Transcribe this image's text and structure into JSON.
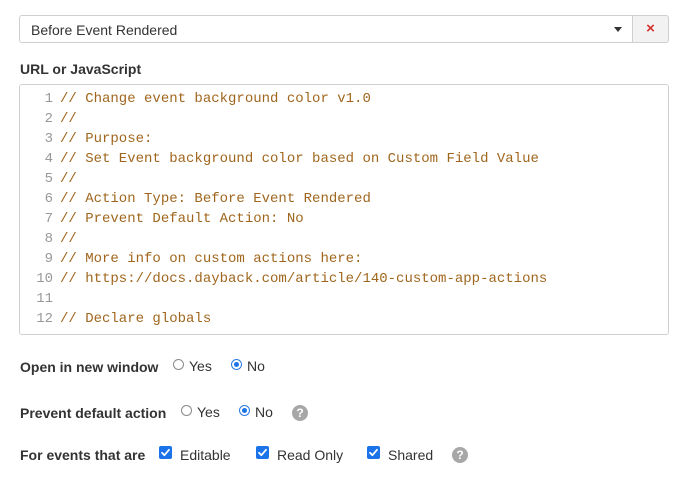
{
  "event_select": {
    "value": "Before Event Rendered",
    "clear_icon": "×"
  },
  "url_field": {
    "label": "URL or JavaScript"
  },
  "editor": {
    "lines": [
      {
        "num": "1",
        "text": "// Change event background color v1.0"
      },
      {
        "num": "2",
        "text": "//"
      },
      {
        "num": "3",
        "text": "// Purpose:"
      },
      {
        "num": "4",
        "text": "// Set Event background color based on Custom Field Value"
      },
      {
        "num": "5",
        "text": "//"
      },
      {
        "num": "6",
        "text": "// Action Type: Before Event Rendered"
      },
      {
        "num": "7",
        "text": "// Prevent Default Action: No"
      },
      {
        "num": "8",
        "text": "//"
      },
      {
        "num": "9",
        "text": "// More info on custom actions here:"
      },
      {
        "num": "10",
        "text": "// https://docs.dayback.com/article/140-custom-app-actions"
      },
      {
        "num": "11",
        "text": ""
      },
      {
        "num": "12",
        "text": "// Declare globals"
      }
    ]
  },
  "open_new_window": {
    "label": "Open in new window",
    "options": [
      {
        "label": "Yes",
        "checked": false
      },
      {
        "label": "No",
        "checked": true
      }
    ]
  },
  "prevent_default": {
    "label": "Prevent default action",
    "options": [
      {
        "label": "Yes",
        "checked": false
      },
      {
        "label": "No",
        "checked": true
      }
    ],
    "help": "?"
  },
  "events_filter": {
    "label": "For events that are",
    "options": [
      {
        "label": "Editable",
        "checked": true
      },
      {
        "label": "Read Only",
        "checked": true
      },
      {
        "label": "Shared",
        "checked": true
      }
    ],
    "help": "?"
  },
  "colors": {
    "accent": "#1a73e8",
    "code_comment": "#a0661d",
    "clear": "#d2322d"
  }
}
